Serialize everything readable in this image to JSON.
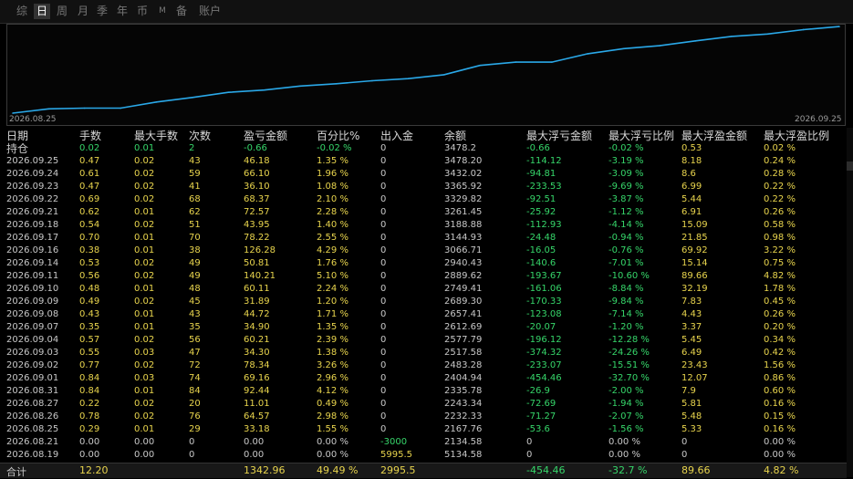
{
  "tabs": [
    {
      "label": "综",
      "active": false
    },
    {
      "label": "日",
      "active": true
    },
    {
      "label": "周",
      "active": false
    },
    {
      "label": "月",
      "active": false
    },
    {
      "label": "季",
      "active": false
    },
    {
      "label": "年",
      "active": false
    },
    {
      "label": "币",
      "active": false
    },
    {
      "label": "M",
      "active": false
    },
    {
      "label": "备",
      "active": false
    },
    {
      "label": "账户",
      "active": false
    }
  ],
  "chart_data": {
    "type": "line",
    "title": "",
    "x_start_label": "2026.08.25",
    "x_end_label": "2026.09.25",
    "x": [
      "2026.08.25",
      "2026.08.26",
      "2026.08.27",
      "2026.08.28",
      "2026.08.31",
      "2026.09.01",
      "2026.09.02",
      "2026.09.03",
      "2026.09.04",
      "2026.09.07",
      "2026.09.08",
      "2026.09.09",
      "2026.09.10",
      "2026.09.11",
      "2026.09.14",
      "2026.09.15",
      "2026.09.16",
      "2026.09.17",
      "2026.09.18",
      "2026.09.21",
      "2026.09.22",
      "2026.09.23",
      "2026.09.24",
      "2026.09.25"
    ],
    "series": [
      {
        "color": "#2aa8e8",
        "values": [
          2167.76,
          2232.33,
          2243.34,
          2243.34,
          2335.78,
          2404.94,
          2483.28,
          2517.58,
          2577.79,
          2612.69,
          2657.41,
          2689.3,
          2749.41,
          2889.62,
          2940.43,
          2940.43,
          3066.71,
          3144.93,
          3188.88,
          3261.45,
          3329.82,
          3365.92,
          3432.02,
          3478.2
        ]
      }
    ]
  },
  "table": {
    "headers": [
      "日期",
      "手数",
      "最大手数",
      "次数",
      "盈亏金额",
      "百分比%",
      "出入金",
      "余额",
      "最大浮亏金额",
      "最大浮亏比例",
      "最大浮盈金额",
      "最大浮盈比例"
    ],
    "position": [
      "持仓",
      "0.02",
      "0.01",
      "2",
      "-0.66",
      "-0.02 %",
      "0",
      "3478.2",
      "-0.66",
      "-0.02 %",
      "0.53",
      "0.02 %"
    ],
    "rows": [
      [
        "2026.09.25",
        "0.47",
        "0.02",
        "43",
        "46.18",
        "1.35 %",
        "0",
        "3478.20",
        "-114.12",
        "-3.19 %",
        "8.18",
        "0.24 %"
      ],
      [
        "2026.09.24",
        "0.61",
        "0.02",
        "59",
        "66.10",
        "1.96 %",
        "0",
        "3432.02",
        "-94.81",
        "-3.09 %",
        "8.6",
        "0.28 %"
      ],
      [
        "2026.09.23",
        "0.47",
        "0.02",
        "41",
        "36.10",
        "1.08 %",
        "0",
        "3365.92",
        "-233.53",
        "-9.69 %",
        "6.99",
        "0.22 %"
      ],
      [
        "2026.09.22",
        "0.69",
        "0.02",
        "68",
        "68.37",
        "2.10 %",
        "0",
        "3329.82",
        "-92.51",
        "-3.87 %",
        "5.44",
        "0.22 %"
      ],
      [
        "2026.09.21",
        "0.62",
        "0.01",
        "62",
        "72.57",
        "2.28 %",
        "0",
        "3261.45",
        "-25.92",
        "-1.12 %",
        "6.91",
        "0.26 %"
      ],
      [
        "2026.09.18",
        "0.54",
        "0.02",
        "51",
        "43.95",
        "1.40 %",
        "0",
        "3188.88",
        "-112.93",
        "-4.14 %",
        "15.09",
        "0.58 %"
      ],
      [
        "2026.09.17",
        "0.70",
        "0.01",
        "70",
        "78.22",
        "2.55 %",
        "0",
        "3144.93",
        "-24.48",
        "-0.94 %",
        "21.85",
        "0.98 %"
      ],
      [
        "2026.09.16",
        "0.38",
        "0.01",
        "38",
        "126.28",
        "4.29 %",
        "0",
        "3066.71",
        "-16.05",
        "-0.76 %",
        "69.92",
        "3.22 %"
      ],
      [
        "2026.09.14",
        "0.53",
        "0.02",
        "49",
        "50.81",
        "1.76 %",
        "0",
        "2940.43",
        "-140.6",
        "-7.01 %",
        "15.14",
        "0.75 %"
      ],
      [
        "2026.09.11",
        "0.56",
        "0.02",
        "49",
        "140.21",
        "5.10 %",
        "0",
        "2889.62",
        "-193.67",
        "-10.60 %",
        "89.66",
        "4.82 %"
      ],
      [
        "2026.09.10",
        "0.48",
        "0.01",
        "48",
        "60.11",
        "2.24 %",
        "0",
        "2749.41",
        "-161.06",
        "-8.84 %",
        "32.19",
        "1.78 %"
      ],
      [
        "2026.09.09",
        "0.49",
        "0.02",
        "45",
        "31.89",
        "1.20 %",
        "0",
        "2689.30",
        "-170.33",
        "-9.84 %",
        "7.83",
        "0.45 %"
      ],
      [
        "2026.09.08",
        "0.43",
        "0.01",
        "43",
        "44.72",
        "1.71 %",
        "0",
        "2657.41",
        "-123.08",
        "-7.14 %",
        "4.43",
        "0.26 %"
      ],
      [
        "2026.09.07",
        "0.35",
        "0.01",
        "35",
        "34.90",
        "1.35 %",
        "0",
        "2612.69",
        "-20.07",
        "-1.20 %",
        "3.37",
        "0.20 %"
      ],
      [
        "2026.09.04",
        "0.57",
        "0.02",
        "56",
        "60.21",
        "2.39 %",
        "0",
        "2577.79",
        "-196.12",
        "-12.28 %",
        "5.45",
        "0.34 %"
      ],
      [
        "2026.09.03",
        "0.55",
        "0.03",
        "47",
        "34.30",
        "1.38 %",
        "0",
        "2517.58",
        "-374.32",
        "-24.26 %",
        "6.49",
        "0.42 %"
      ],
      [
        "2026.09.02",
        "0.77",
        "0.02",
        "72",
        "78.34",
        "3.26 %",
        "0",
        "2483.28",
        "-233.07",
        "-15.51 %",
        "23.43",
        "1.56 %"
      ],
      [
        "2026.09.01",
        "0.84",
        "0.03",
        "74",
        "69.16",
        "2.96 %",
        "0",
        "2404.94",
        "-454.46",
        "-32.70 %",
        "12.07",
        "0.86 %"
      ],
      [
        "2026.08.31",
        "0.84",
        "0.01",
        "84",
        "92.44",
        "4.12 %",
        "0",
        "2335.78",
        "-26.9",
        "-2.00 %",
        "7.9",
        "0.60 %"
      ],
      [
        "2026.08.27",
        "0.22",
        "0.02",
        "20",
        "11.01",
        "0.49 %",
        "0",
        "2243.34",
        "-72.69",
        "-1.94 %",
        "5.81",
        "0.16 %"
      ],
      [
        "2026.08.26",
        "0.78",
        "0.02",
        "76",
        "64.57",
        "2.98 %",
        "0",
        "2232.33",
        "-71.27",
        "-2.07 %",
        "5.48",
        "0.15 %"
      ],
      [
        "2026.08.25",
        "0.29",
        "0.01",
        "29",
        "33.18",
        "1.55 %",
        "0",
        "2167.76",
        "-53.6",
        "-1.56 %",
        "5.33",
        "0.16 %"
      ],
      [
        "2026.08.21",
        "0.00",
        "0.00",
        "0",
        "0.00",
        "0.00 %",
        "-3000",
        "2134.58",
        "0",
        "0.00 %",
        "0",
        "0.00 %"
      ],
      [
        "2026.08.19",
        "0.00",
        "0.00",
        "0",
        "0.00",
        "0.00 %",
        "5995.5",
        "5134.58",
        "0",
        "0.00 %",
        "0",
        "0.00 %"
      ]
    ],
    "total": [
      "合计",
      "12.20",
      "",
      "",
      "1342.96",
      "49.49 %",
      "2995.5",
      "",
      "-454.46",
      "-32.7 %",
      "89.66",
      "4.82 %"
    ]
  },
  "colors": {
    "value_yellow": "#e8d44d",
    "value_green": "#36d66a",
    "line_blue": "#2aa8e8"
  }
}
